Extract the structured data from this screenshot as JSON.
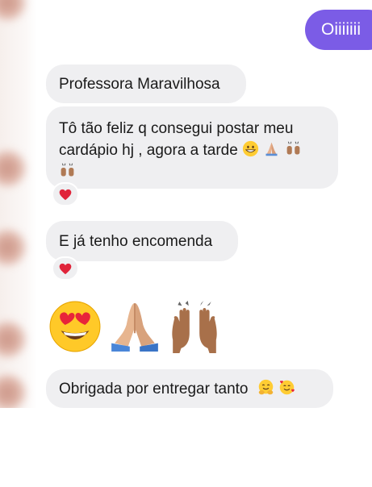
{
  "sent": {
    "text": "Oiiiiiii"
  },
  "messages": {
    "name_line": "Professora Maravilhosa",
    "long_text": "Tô tão feliz q consegui postar meu cardápio hj , agora a tarde",
    "encomenda": "E já tenho encomenda",
    "thanks": "Obrigada por entregar tanto"
  },
  "reactions": {
    "heart": "❤️"
  },
  "icons": {
    "grin": "grinning-face-icon",
    "pray": "folded-hands-icon",
    "raised": "raised-hands-icon",
    "heart_eyes": "heart-eyes-icon",
    "hug": "hugging-face-icon",
    "hearts_face": "smiling-face-with-hearts-icon"
  },
  "colors": {
    "sent_bubble": "#7b5ce6",
    "received_bubble": "#efeff1",
    "heart": "#e0243a"
  }
}
